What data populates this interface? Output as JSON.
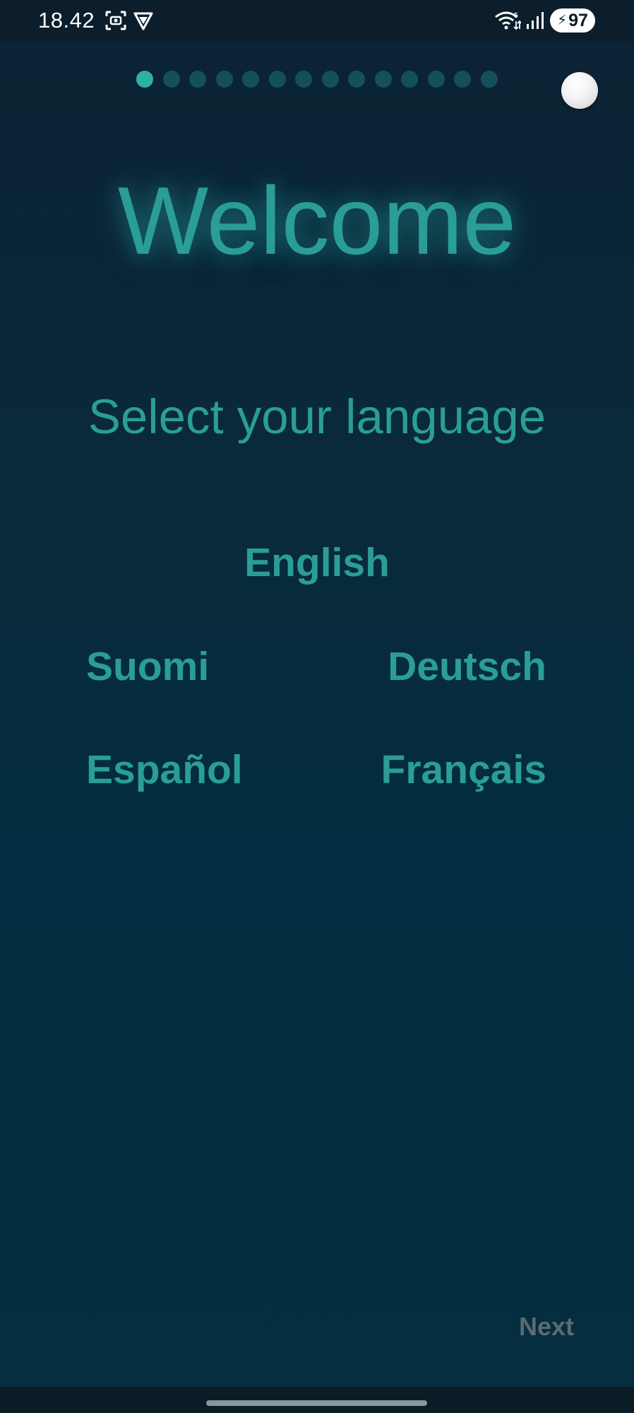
{
  "status_bar": {
    "time": "18.42",
    "battery_level": "97",
    "icons": [
      "screenshot-icon",
      "shield-icon",
      "wifi-icon",
      "cellular-signal-icon",
      "battery-charging-icon"
    ]
  },
  "pager": {
    "total_steps": 14,
    "current_step": 1
  },
  "header": {
    "title": "Welcome",
    "subtitle": "Select your language"
  },
  "languages": {
    "english": "English",
    "suomi": "Suomi",
    "deutsch": "Deutsch",
    "espanol": "Español",
    "francais": "Français"
  },
  "footer": {
    "next_label": "Next"
  },
  "colors": {
    "accent": "#2a9e96",
    "dot_active": "#2fb0a4",
    "dot_inactive": "#15505a",
    "background": "#032d40",
    "next_disabled": "#5b6b74"
  }
}
